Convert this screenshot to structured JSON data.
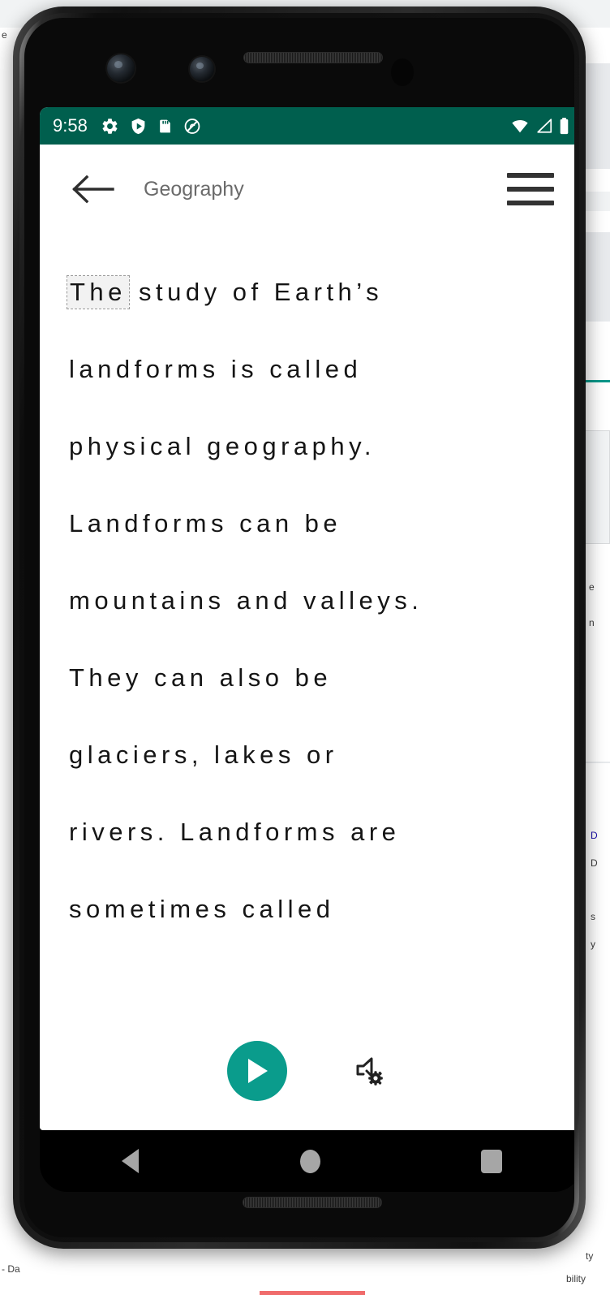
{
  "device": {
    "frame_name": "android-phone-mockup",
    "hardware": {
      "front_camera_main": "camera-lens-icon",
      "front_camera_secondary": "camera-lens-icon",
      "earpiece": "speaker-grille",
      "sensor": "proximity-sensor-dot",
      "bottom_speaker": "speaker-grille"
    }
  },
  "status_bar": {
    "time": "9:58",
    "background_color": "#005F4E",
    "left_icons": [
      {
        "name": "settings-gear-icon",
        "glyph": "gear"
      },
      {
        "name": "play-protect-shield-icon",
        "glyph": "shield-play"
      },
      {
        "name": "sd-card-icon",
        "glyph": "sd-card"
      },
      {
        "name": "do-not-disturb-icon",
        "glyph": "circle-slash"
      }
    ],
    "right_icons": [
      {
        "name": "wifi-icon",
        "glyph": "wifi-full"
      },
      {
        "name": "cell-signal-icon",
        "glyph": "signal-empty"
      },
      {
        "name": "battery-icon",
        "glyph": "battery-full"
      }
    ]
  },
  "app_bar": {
    "back_label": "back-arrow",
    "title": "Geography",
    "title_color": "#6B6B6B",
    "menu_label": "hamburger-menu"
  },
  "reader": {
    "full_text": "The study of Earth’s landforms is called physical geography. Landforms can be mountains and valleys. They can also be glaciers, lakes or rivers. Landforms are sometimes called",
    "highlighted_word": "The",
    "lines": [
      {
        "prefix": "",
        "highlight": "The",
        "suffix": " study of Earth’s"
      },
      {
        "prefix": "landforms is called",
        "highlight": "",
        "suffix": ""
      },
      {
        "prefix": "physical geography.",
        "highlight": "",
        "suffix": ""
      },
      {
        "prefix": "Landforms can be",
        "highlight": "",
        "suffix": ""
      },
      {
        "prefix": "mountains and valleys.",
        "highlight": "",
        "suffix": ""
      },
      {
        "prefix": "They can also be",
        "highlight": "",
        "suffix": ""
      },
      {
        "prefix": "glaciers, lakes or",
        "highlight": "",
        "suffix": ""
      },
      {
        "prefix": "rivers. Landforms are",
        "highlight": "",
        "suffix": ""
      },
      {
        "prefix": "sometimes called",
        "highlight": "",
        "suffix": ""
      }
    ]
  },
  "controls": {
    "play": {
      "name": "play-button",
      "color": "#0A9C8C",
      "glyph": "play-triangle"
    },
    "tts_settings": {
      "name": "speaker-settings-button",
      "color": "#222222",
      "glyph": "speaker-gear"
    }
  },
  "nav_bar": {
    "background_color": "#000000",
    "icon_color": "#A6A6A6",
    "buttons": [
      {
        "name": "nav-back-button",
        "glyph": "triangle-left"
      },
      {
        "name": "nav-home-button",
        "glyph": "circle"
      },
      {
        "name": "nav-recents-button",
        "glyph": "square"
      }
    ]
  },
  "background_page": {
    "visible_fragments": [
      "e",
      "- Da",
      "bility",
      "ty",
      "s",
      "e",
      "D",
      "n",
      "y"
    ]
  }
}
